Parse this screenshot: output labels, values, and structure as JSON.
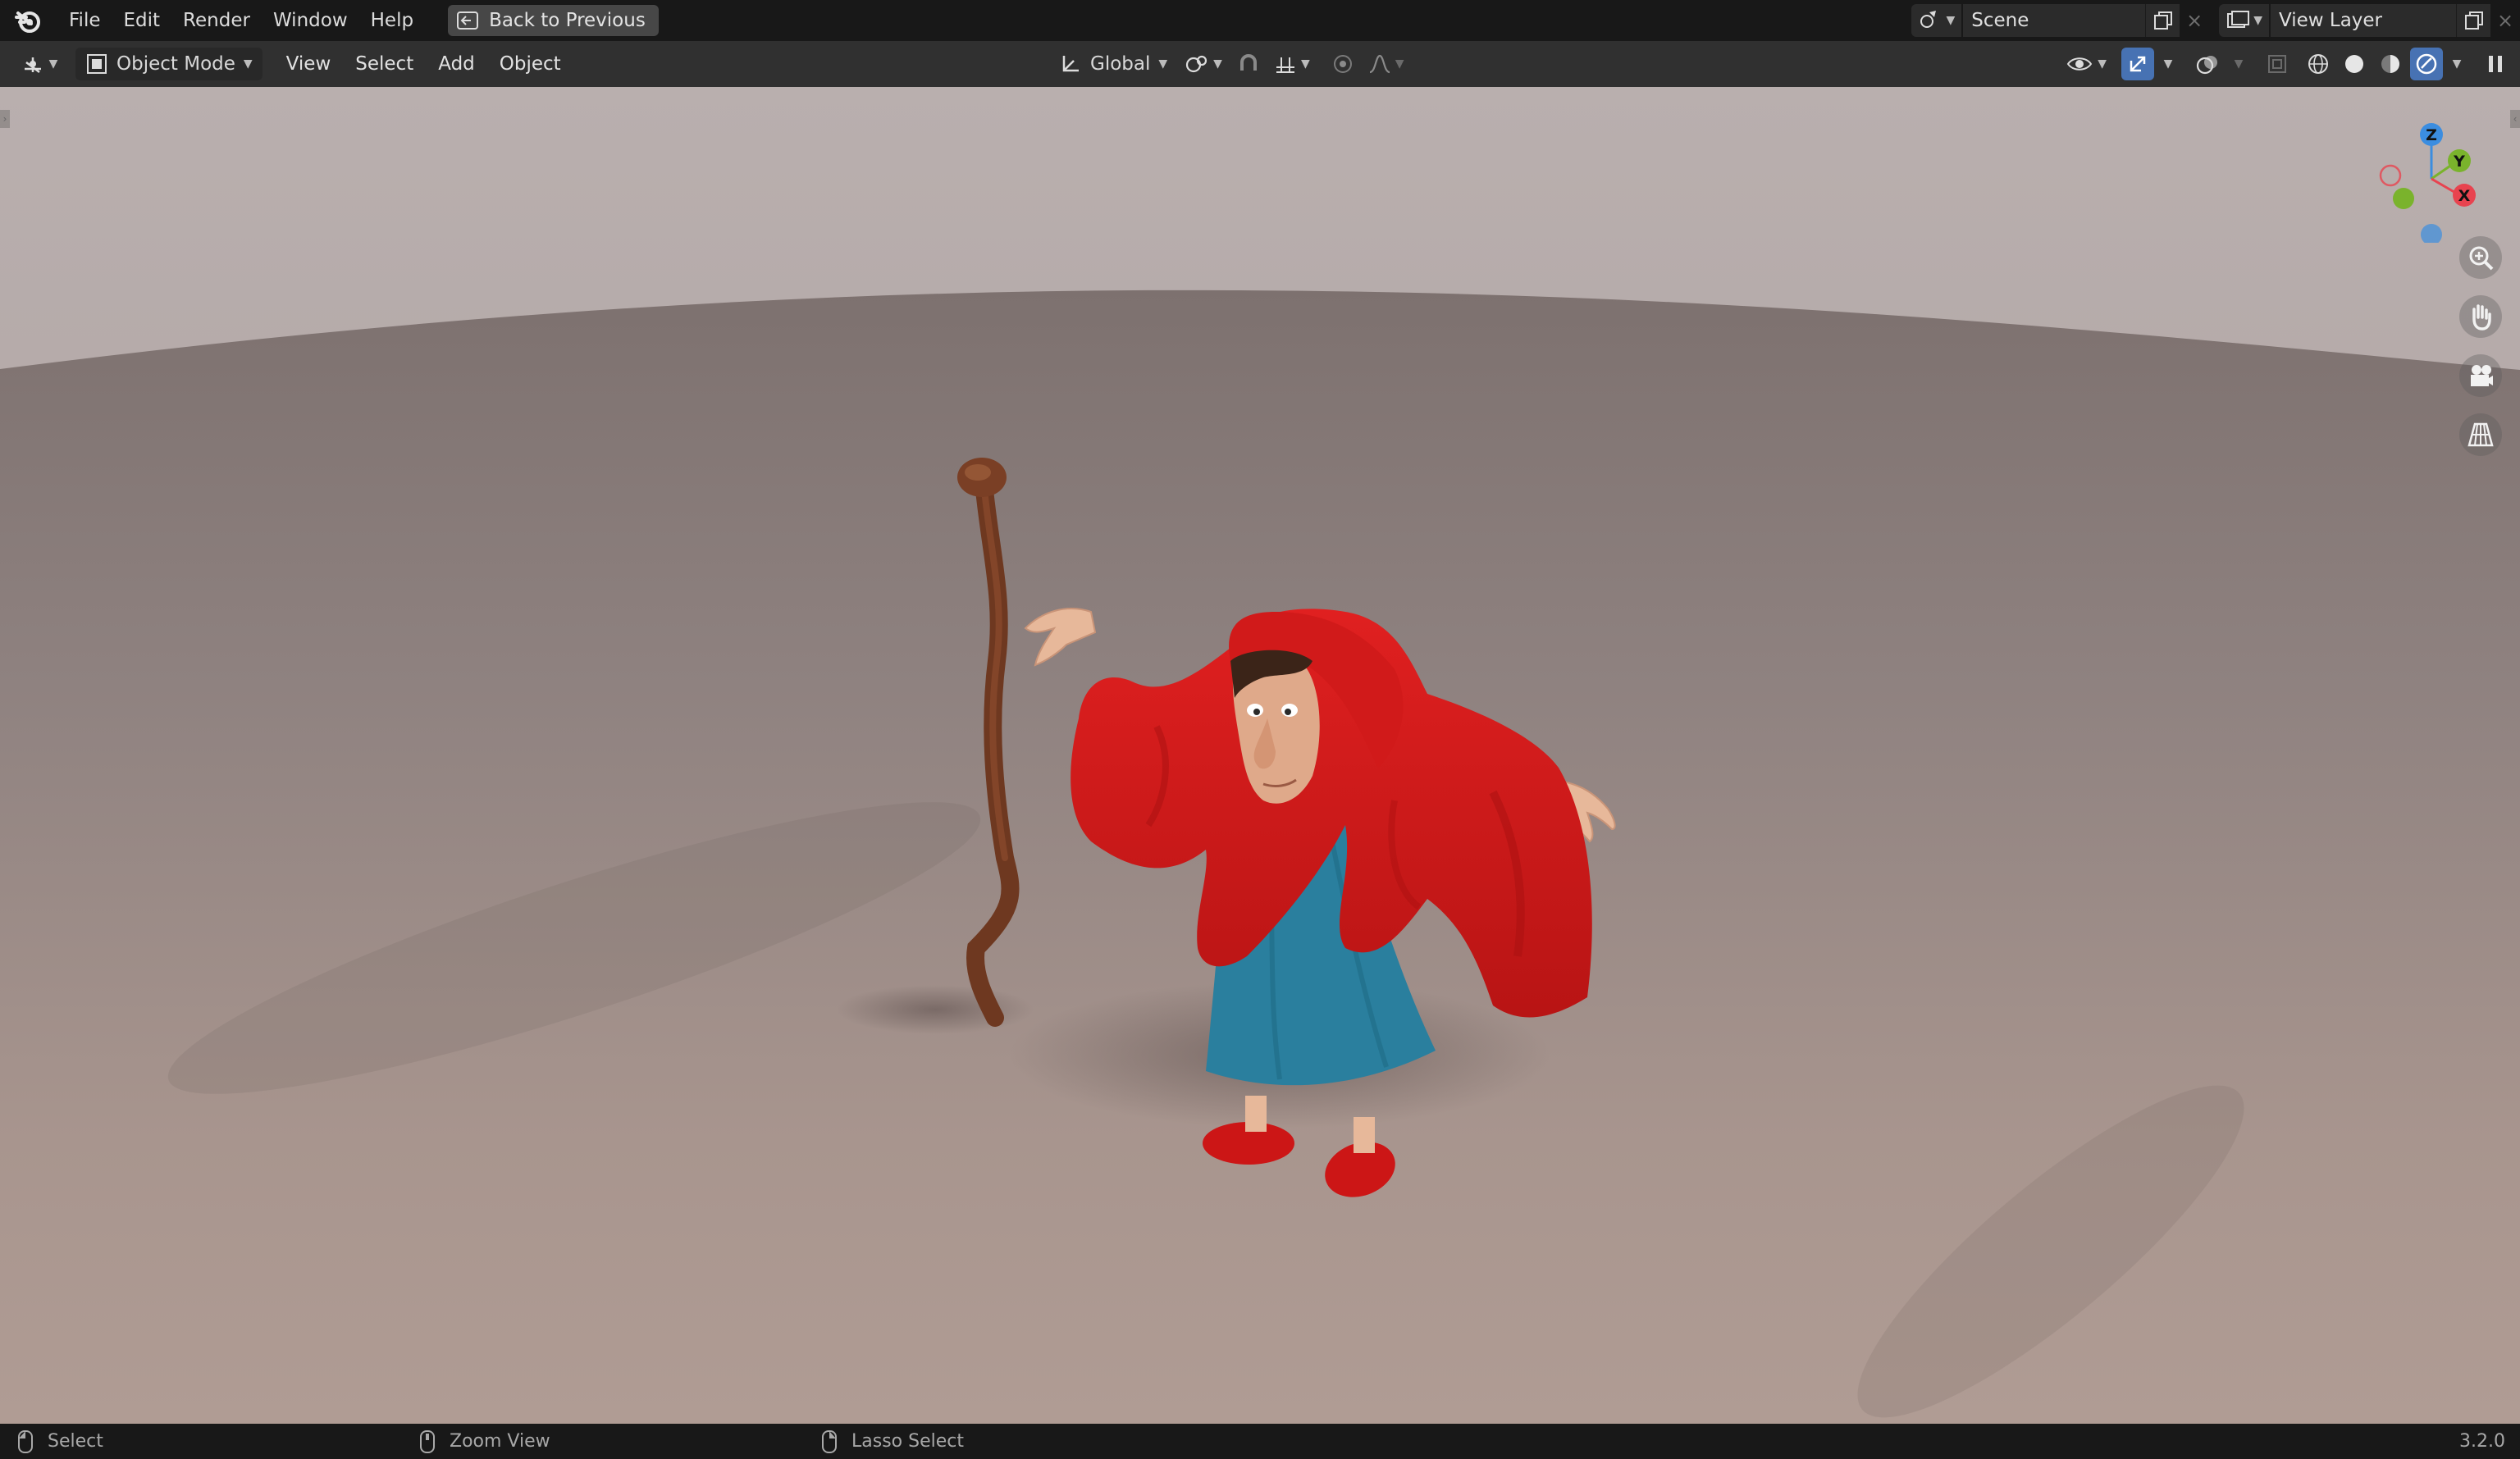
{
  "topbar": {
    "menus": [
      "File",
      "Edit",
      "Render",
      "Window",
      "Help"
    ],
    "back_label": "Back to Previous",
    "scene_label": "Scene",
    "view_layer_label": "View Layer"
  },
  "header": {
    "mode_label": "Object Mode",
    "menus": [
      "View",
      "Select",
      "Add",
      "Object"
    ],
    "orientation_label": "Global"
  },
  "gizmo": {
    "z_label": "Z",
    "y_label": "Y",
    "x_label": "X"
  },
  "statusbar": {
    "select_label": "Select",
    "zoom_label": "Zoom View",
    "lasso_label": "Lasso Select",
    "version": "3.2.0"
  },
  "colors": {
    "accent": "#4772b3",
    "cloak_red": "#d11a1a",
    "dress_blue": "#2a7f9e",
    "staff_brown": "#7a3f25",
    "axis_x": "#e8434f",
    "axis_y": "#7ab32c",
    "axis_z": "#3b8de0"
  }
}
